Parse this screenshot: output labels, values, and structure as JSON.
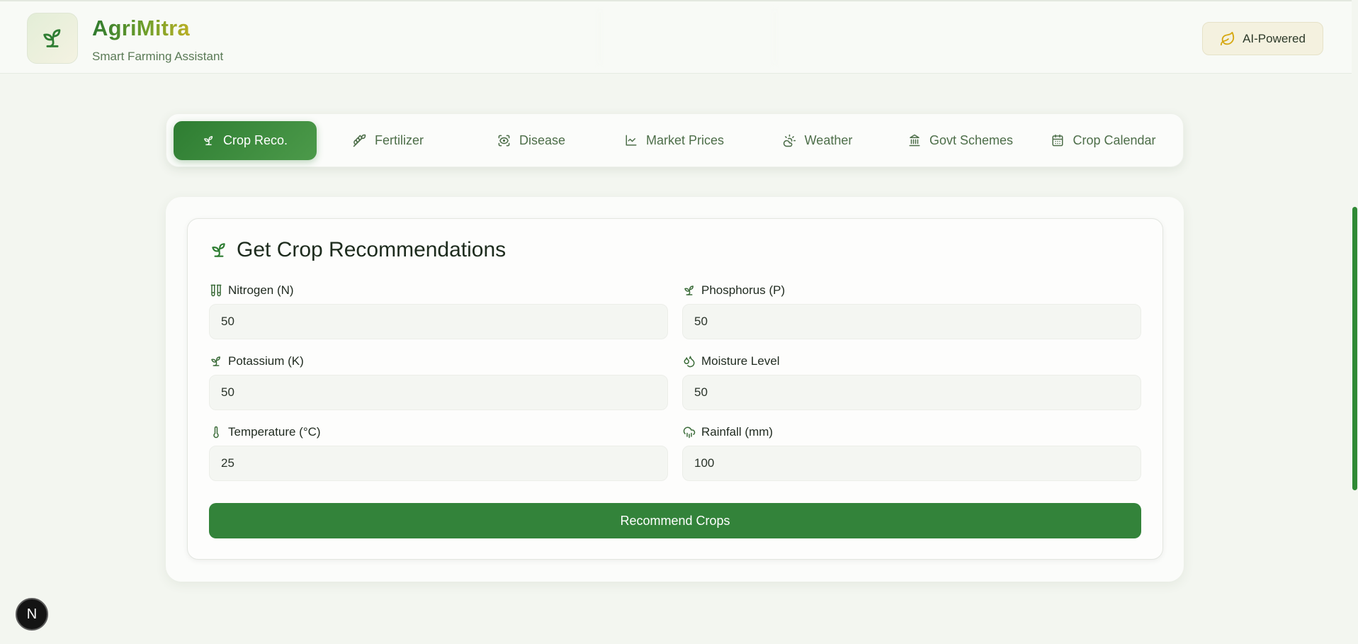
{
  "header": {
    "brand_name": "AgriMitra",
    "subtitle": "Smart Farming Assistant",
    "logo_icon": "sprout-icon",
    "badge_label": "AI-Powered",
    "badge_icon": "leaf-icon"
  },
  "tabs": [
    {
      "label": "Crop Reco.",
      "icon": "sprout-icon",
      "active": true
    },
    {
      "label": "Fertilizer",
      "icon": "wheat-icon",
      "active": false
    },
    {
      "label": "Disease",
      "icon": "scan-eye-icon",
      "active": false
    },
    {
      "label": "Market Prices",
      "icon": "line-chart-icon",
      "active": false
    },
    {
      "label": "Weather",
      "icon": "sun-cloud-icon",
      "active": false
    },
    {
      "label": "Govt Schemes",
      "icon": "landmark-icon",
      "active": false
    },
    {
      "label": "Crop Calendar",
      "icon": "calendar-icon",
      "active": false
    }
  ],
  "form": {
    "title": "Get Crop Recommendations",
    "title_icon": "sprout-icon",
    "fields": [
      {
        "label": "Nitrogen (N)",
        "value": "50",
        "icon": "test-tubes-icon"
      },
      {
        "label": "Phosphorus (P)",
        "value": "50",
        "icon": "sprout-icon"
      },
      {
        "label": "Potassium (K)",
        "value": "50",
        "icon": "sprout-icon"
      },
      {
        "label": "Moisture Level",
        "value": "50",
        "icon": "droplets-icon"
      },
      {
        "label": "Temperature (°C)",
        "value": "25",
        "icon": "thermometer-icon"
      },
      {
        "label": "Rainfall (mm)",
        "value": "100",
        "icon": "cloud-rain-icon"
      }
    ],
    "submit_label": "Recommend Crops"
  },
  "dev_badge": {
    "label": "N"
  },
  "colors": {
    "primary": "#2e7d32",
    "button": "#33833a",
    "background": "#f3f6f0",
    "tab_text": "#4d6e49",
    "accent_gold": "#b9ae24"
  }
}
